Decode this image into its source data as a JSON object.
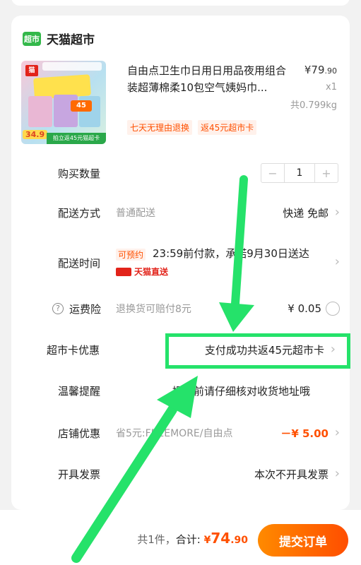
{
  "store": {
    "logo_text": "超市",
    "name": "天猫超市"
  },
  "product": {
    "title": "自由点卫生巾日用日用品夜用组合装超薄棉柔10包空气姨妈巾...",
    "price_main": "¥79",
    "price_decimal": ".90",
    "quantity": "x1",
    "weight": "共0.799kg",
    "tags": [
      "七天无理由退换",
      "返45元超市卡"
    ],
    "thumb_price": "34.9",
    "thumb_band": "拍立返45元猫超卡",
    "thumb_badge": "45"
  },
  "rows": {
    "quantity": {
      "label": "购买数量",
      "minus": "−",
      "value": "1",
      "plus": "+"
    },
    "delivery_method": {
      "label": "配送方式",
      "value": "普通配送",
      "right": "快递 免邮"
    },
    "delivery_time": {
      "label": "配送时间",
      "badge": "可预约",
      "text": "23:59前付款，承诺9月30日送达",
      "carrier": "天猫直送"
    },
    "insurance": {
      "label": "运费险",
      "value": "退换货可赔付8元",
      "right": "¥ 0.05"
    },
    "supermarket_card": {
      "label": "超市卡优惠",
      "right": "支付成功共返45元超市卡"
    },
    "reminder": {
      "label": "温馨提醒",
      "value": "提交前请仔细核对收货地址哦"
    },
    "store_discount": {
      "label": "店铺优惠",
      "value": "省5元:FREEMORE/自由点",
      "right": "－¥ 5.00"
    },
    "invoice": {
      "label": "开具发票",
      "right": "本次不开具发票"
    }
  },
  "footer": {
    "count_text": "共1件，",
    "total_label": "合计:",
    "currency": "¥",
    "total_main": "74",
    "total_decimal": ".90",
    "submit_label": "提交订单"
  },
  "colors": {
    "accent": "#ff5000",
    "brand_green": "#33b84a",
    "annotation_green": "#25e26a"
  }
}
